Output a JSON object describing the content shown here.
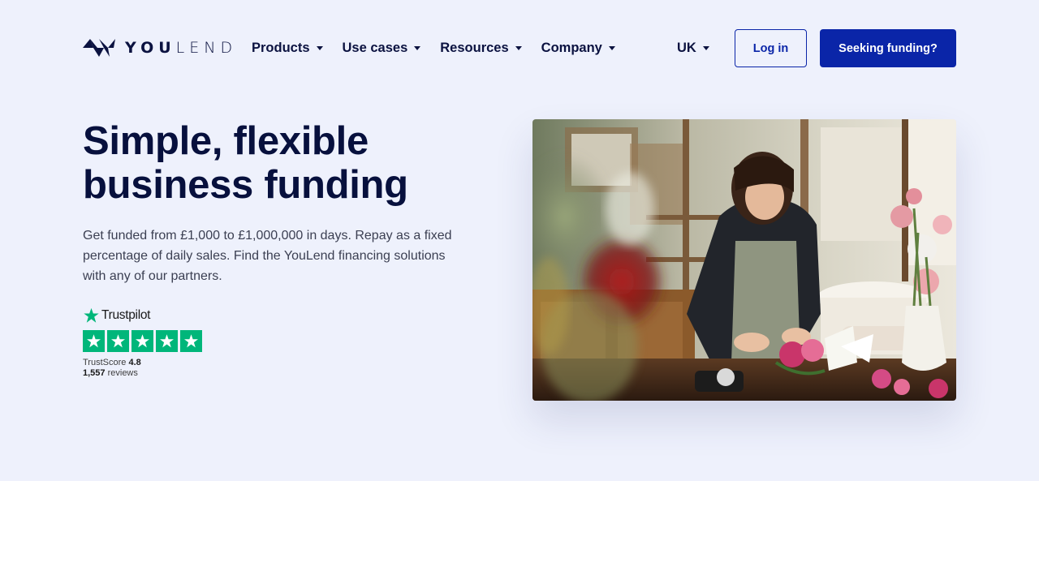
{
  "brand": {
    "name_part1": "YOU",
    "name_part2": "LEND"
  },
  "nav": {
    "items": [
      {
        "label": "Products"
      },
      {
        "label": "Use cases"
      },
      {
        "label": "Resources"
      },
      {
        "label": "Company"
      }
    ],
    "region": "UK",
    "login_label": "Log in",
    "cta_label": "Seeking funding?"
  },
  "hero": {
    "headline_line1": "Simple, flexible",
    "headline_line2": "business funding",
    "subtext": "Get funded from £1,000 to £1,000,000 in days. Repay as a fixed percentage of daily sales. Find the YouLend financing solutions with any of our partners."
  },
  "trustpilot": {
    "brand": "Trustpilot",
    "score_label": "TrustScore",
    "score": "4.8",
    "reviews_count": "1,557",
    "reviews_label": "reviews",
    "stars": 5
  },
  "colors": {
    "hero_bg": "#eef1fc",
    "primary": "#0a25a8",
    "heading": "#07103d",
    "trustpilot_green": "#00b67a"
  },
  "icons": {
    "logo": "youlend-logo-icon",
    "caret": "caret-down-icon",
    "trustpilot": "trustpilot-star-icon"
  }
}
